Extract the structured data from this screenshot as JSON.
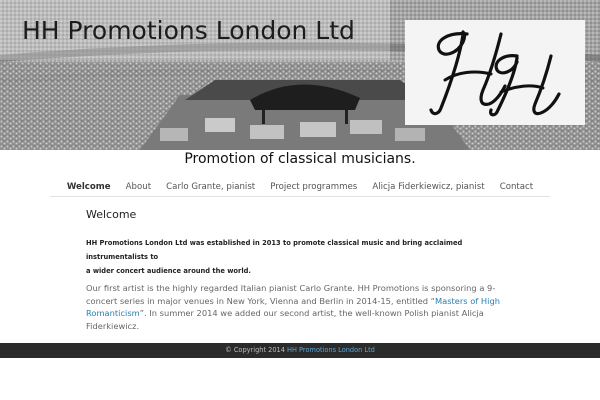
{
  "header": {
    "site_title": "HH Promotions London Ltd",
    "logo_text": "HH"
  },
  "tagline": "Promotion of classical musicians.",
  "nav": {
    "items": [
      {
        "label": "Welcome",
        "active": true
      },
      {
        "label": "About"
      },
      {
        "label": "Carlo Grante, pianist"
      },
      {
        "label": "Project programmes"
      },
      {
        "label": "Alicja Fiderkiewicz, pianist"
      },
      {
        "label": "Contact"
      }
    ]
  },
  "content": {
    "heading": "Welcome",
    "lead_line1": "HH Promotions London Ltd was established in 2013 to promote classical music and bring acclaimed instrumentalists to",
    "lead_line2": "a wider concert audience around the world.",
    "body_part1": "Our first artist is the highly regarded Italian pianist Carlo Grante. HH Promotions is  sponsoring a 9-concert series in major venues in New York, Vienna and Berlin in 2014-15, entitled “",
    "body_link": "Masters of High Romanticism",
    "body_part2": "”. In summer 2014 we added our second artist, the well-known Polish pianist Alicja Fiderkiewicz."
  },
  "footer": {
    "copyright": "© Copyright 2014",
    "link": "HH Promotions London Ltd"
  },
  "colors": {
    "link": "#2a7fb0",
    "footer_bg": "#2b2b2b",
    "footer_link": "#5aa7d6"
  }
}
